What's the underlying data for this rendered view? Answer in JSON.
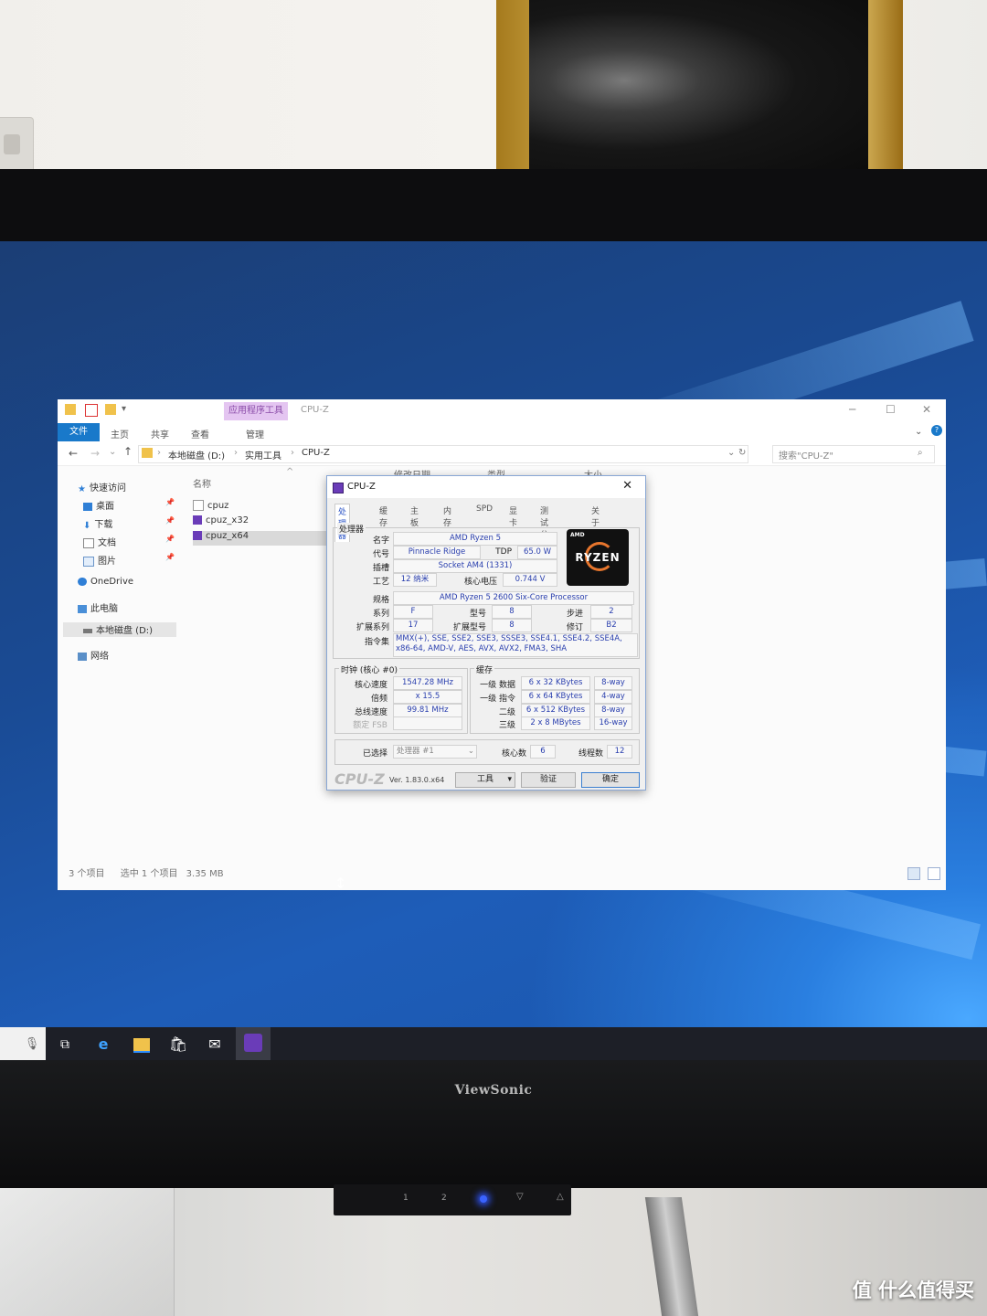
{
  "explorer": {
    "title": "CPU-Z",
    "app_tools_label": "应用程序工具",
    "ribbon_tabs": [
      "文件",
      "主页",
      "共享",
      "查看",
      "管理"
    ],
    "breadcrumb": [
      "本地磁盘 (D:)",
      "实用工具",
      "CPU-Z"
    ],
    "search_placeholder": "搜索\"CPU-Z\"",
    "nav": {
      "quick_access": "快速访问",
      "quick_items": [
        "桌面",
        "下载",
        "文档",
        "图片"
      ],
      "onedrive": "OneDrive",
      "this_pc": "此电脑",
      "local_disk": "本地磁盘 (D:)",
      "network": "网络"
    },
    "columns": {
      "name": "名称",
      "modified": "修改日期",
      "type": "类型",
      "size": "大小"
    },
    "files": [
      "cpuz",
      "cpuz_x32",
      "cpuz_x64"
    ],
    "status": {
      "items": "3 个项目",
      "selected": "选中 1 个项目",
      "size": "3.35 MB"
    }
  },
  "cpuz": {
    "title": "CPU-Z",
    "tabs": [
      "处理器",
      "缓存",
      "主板",
      "内存",
      "SPD",
      "显卡",
      "测试分数",
      "关于"
    ],
    "processor_group": "处理器",
    "labels": {
      "name": "名字",
      "codename": "代号",
      "tdp": "TDP",
      "package": "插槽",
      "technology": "工艺",
      "core_voltage": "核心电压",
      "specification": "规格",
      "family": "系列",
      "model": "型号",
      "stepping": "步进",
      "ext_family": "扩展系列",
      "ext_model": "扩展型号",
      "revision": "修订",
      "instructions": "指令集"
    },
    "values": {
      "name": "AMD Ryzen 5",
      "codename": "Pinnacle Ridge",
      "tdp": "65.0 W",
      "package": "Socket AM4 (1331)",
      "technology": "12 纳米",
      "core_voltage": "0.744 V",
      "specification": "AMD Ryzen 5 2600 Six-Core Processor",
      "family": "F",
      "model": "8",
      "stepping": "2",
      "ext_family": "17",
      "ext_model": "8",
      "revision": "B2",
      "instructions": "MMX(+), SSE, SSE2, SSE3, SSSE3, SSE4.1, SSE4.2, SSE4A, x86-64, AMD-V, AES, AVX, AVX2, FMA3, SHA"
    },
    "logo": {
      "brand": "AMD",
      "name": "RYZEN"
    },
    "clocks": {
      "group": "时钟 (核心 #0)",
      "core_speed_label": "核心速度",
      "core_speed": "1547.28 MHz",
      "multiplier_label": "倍频",
      "multiplier": "x 15.5",
      "bus_speed_label": "总线速度",
      "bus_speed": "99.81 MHz",
      "rated_fsb_label": "额定 FSB"
    },
    "cache": {
      "group": "缓存",
      "rows": [
        {
          "label": "一级 数据",
          "size": "6 x 32 KBytes",
          "way": "8-way"
        },
        {
          "label": "一级 指令",
          "size": "6 x 64 KBytes",
          "way": "4-way"
        },
        {
          "label": "二级",
          "size": "6 x 512 KBytes",
          "way": "8-way"
        },
        {
          "label": "三级",
          "size": "2 x 8 MBytes",
          "way": "16-way"
        }
      ]
    },
    "selection": {
      "label": "已选择",
      "value": "处理器 #1",
      "cores_label": "核心数",
      "cores": "6",
      "threads_label": "线程数",
      "threads": "12"
    },
    "footer": {
      "logo": "CPU-Z",
      "version": "Ver. 1.83.0.x64",
      "tools": "工具",
      "validate": "验证",
      "ok": "确定"
    }
  },
  "monitor": {
    "brand": "ViewSonic",
    "buttons": [
      "1",
      "2"
    ]
  },
  "watermark": "值 什么值得买",
  "colors": {
    "accent": "#1979ca",
    "desktop": "#1a4b95",
    "cpuz_value": "#2a3fae",
    "app_tools": "#e4c5f1"
  }
}
